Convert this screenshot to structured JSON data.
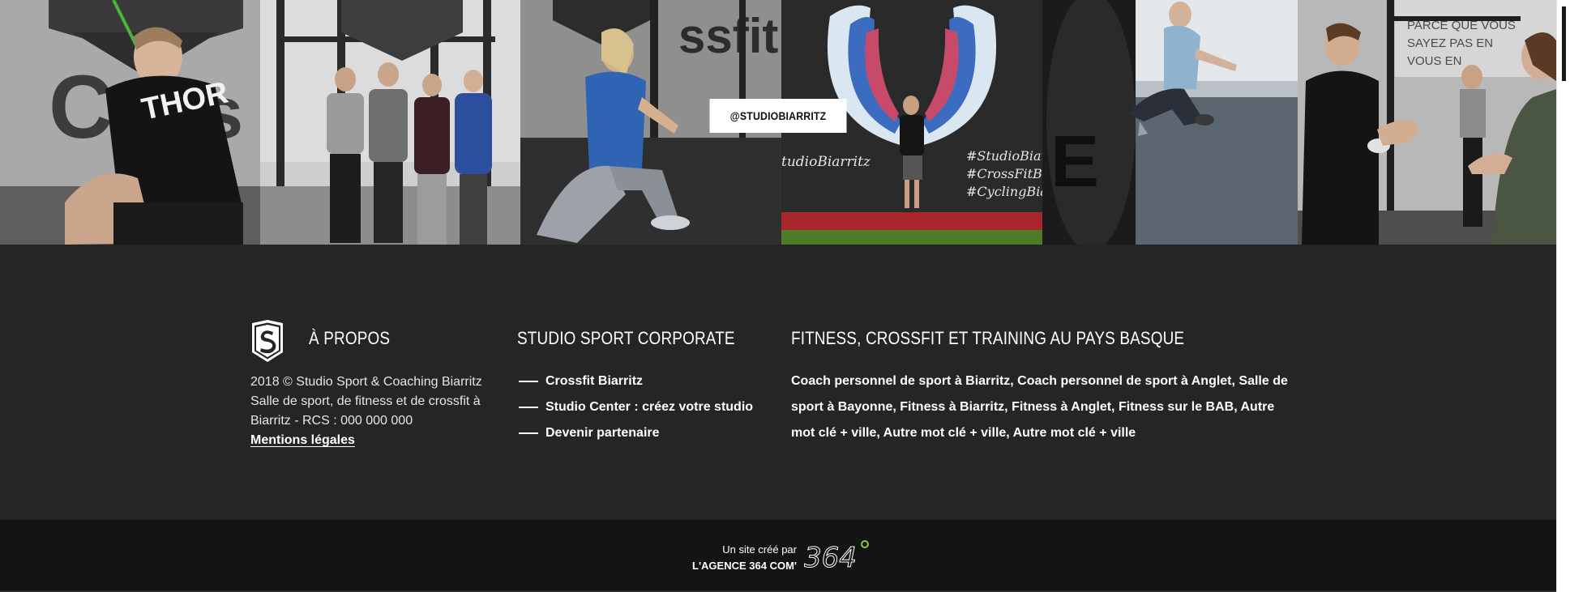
{
  "gallery": {
    "handle": "@STUDIOBIARRITZ",
    "photos": [
      {
        "id": "photo-athlete-thor"
      },
      {
        "id": "photo-team-group"
      },
      {
        "id": "photo-lunge-woman"
      },
      {
        "id": "photo-wings-mural",
        "mural_text": [
          "tudioBiarritz",
          "#StudioBiarri",
          "#CrossFitBiar",
          "#CyclingBiar"
        ]
      },
      {
        "id": "photo-kneeling-woman"
      },
      {
        "id": "photo-chalk-hands",
        "wall_text": [
          "PARCE QUE VOUS",
          "SAYEZ PAS EN",
          "VOUS EN"
        ]
      }
    ]
  },
  "footer": {
    "about": {
      "title": "À PROPOS",
      "line1": "2018 © Studio Sport & Coaching Biarritz",
      "line2": "Salle de sport, de fitness et de crossfit à Biarritz - RCS : 000 000 000",
      "legal_link": "Mentions légales"
    },
    "corporate": {
      "title": "STUDIO SPORT CORPORATE",
      "links": [
        {
          "label": "Crossfit Biarritz"
        },
        {
          "label": "Studio Center : créez votre studio"
        },
        {
          "label": "Devenir partenaire"
        }
      ]
    },
    "fitness": {
      "title": "FITNESS, CROSSFIT ET TRAINING AU PAYS BASQUE",
      "text": "Coach personnel de sport à Biarritz,  Coach personnel de sport à Anglet, Salle de sport à Bayonne, Fitness à Biarritz, Fitness à Anglet, Fitness sur le BAB, Autre mot clé + ville, Autre mot clé + ville, Autre mot clé + ville"
    }
  },
  "credit": {
    "line1": "Un site créé par",
    "line2": "L'AGENCE 364 COM'",
    "brand": "364"
  },
  "colors": {
    "footer_bg": "#252525",
    "credit_bg": "#141414",
    "brand_accent": "#8cc63f"
  }
}
